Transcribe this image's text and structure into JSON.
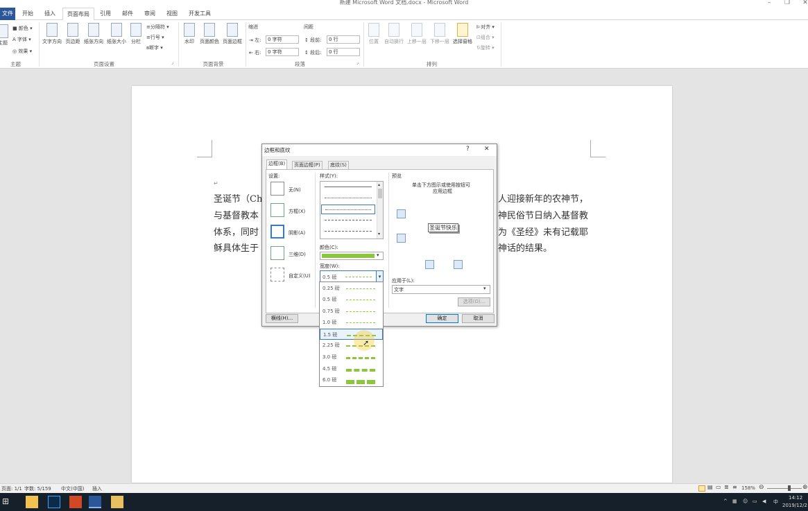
{
  "window": {
    "title": "新建 Microsoft Word 文档.docx - Microsoft Word"
  },
  "tabs": [
    "文件",
    "开始",
    "插入",
    "页面布局",
    "引用",
    "邮件",
    "审阅",
    "视图",
    "开发工具"
  ],
  "ribbon": {
    "theme": {
      "label": "主题",
      "items": [
        "颜色",
        "字体",
        "效果"
      ],
      "btn": "主题"
    },
    "page_setup": {
      "label": "页面设置",
      "buttons": [
        "文字方向",
        "页边距",
        "纸张方向",
        "纸张大小",
        "分栏"
      ],
      "small": [
        "分隔符",
        "行号",
        "断字"
      ]
    },
    "page_bg": {
      "label": "页面背景",
      "buttons": [
        "水印",
        "页面颜色",
        "页面边框"
      ]
    },
    "paragraph": {
      "label": "段落",
      "indent": "缩进",
      "spacing": "间距",
      "left": "左:",
      "right": "右:",
      "before": "段前:",
      "after": "段后:",
      "left_val": "0 字符",
      "right_val": "0 字符",
      "before_val": "0 行",
      "after_val": "0 行"
    },
    "arrange": {
      "label": "排列",
      "buttons": [
        "位置",
        "自动换行",
        "上移一层",
        "下移一层",
        "选择窗格"
      ],
      "small": [
        "对齐",
        "组合",
        "旋转"
      ]
    }
  },
  "document": {
    "lines": [
      {
        "left": "圣诞节（Ch",
        "right": "人迎接新年的农神节，"
      },
      {
        "left": "与基督教本",
        "right": "神民俗节日纳入基督教"
      },
      {
        "left": "体系，同时",
        "right": "为《圣经》未有记载耶"
      },
      {
        "left": "稣具体生于",
        "right": "神话的结果。"
      }
    ]
  },
  "dialog": {
    "title": "边框和底纹",
    "help": "?",
    "close": "✕",
    "tabs": [
      "边框(B)",
      "页面边框(P)",
      "底纹(S)"
    ],
    "settings_label": "设置:",
    "settings": [
      "无(N)",
      "方框(X)",
      "阴影(A)",
      "三维(D)",
      "自定义(U)"
    ],
    "style_label": "样式(Y):",
    "color_label": "颜色(C):",
    "width_label": "宽度(W):",
    "width_value": "0.5 磅",
    "preview_label": "预览",
    "preview_hint_1": "单击下方图示或使用按钮可",
    "preview_hint_2": "应用边框",
    "preview_text": "圣诞节快乐",
    "apply_label": "应用于(L):",
    "apply_value": "文字",
    "options_btn": "选项(O)...",
    "hline_btn": "横线(H)...",
    "ok_btn": "确定",
    "cancel_btn": "取消"
  },
  "width_options": [
    "0.25 磅",
    "0.5 磅",
    "0.75 磅",
    "1.0 磅",
    "1.5 磅",
    "2.25 磅",
    "3.0 磅",
    "4.5 磅",
    "6.0 磅"
  ],
  "width_highlighted": "1.5 磅",
  "status": {
    "page": "页面: 1/1",
    "words": "字数: 5/159",
    "lang": "中文(中国)",
    "mode": "插入",
    "zoom": "158%"
  },
  "taskbar": {
    "time": "14:12",
    "date": "2019/12/2",
    "ime": "中"
  },
  "colors": {
    "accent": "#2b579a",
    "border_green": "#8cc63f",
    "highlight": "#f5c518"
  }
}
